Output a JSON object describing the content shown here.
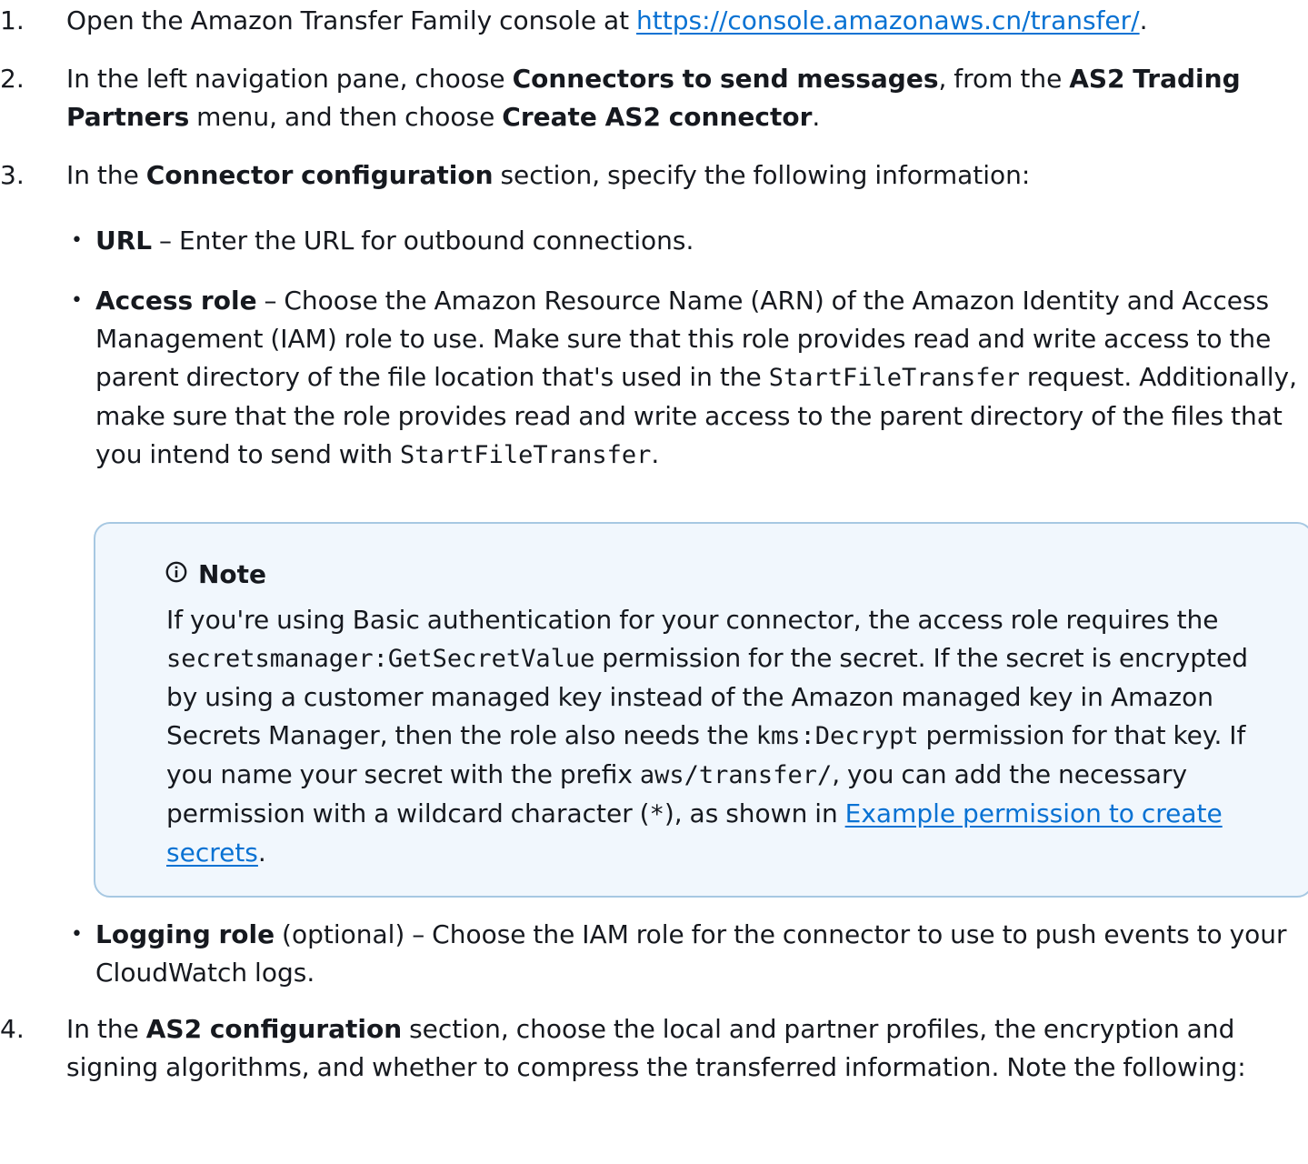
{
  "steps": [
    {
      "num": "1.",
      "t1": "Open the Amazon Transfer Family console at ",
      "link": "https://console.amazonaws.cn/transfer/",
      "t2": "."
    },
    {
      "num": "2.",
      "t1": "In the left navigation pane, choose ",
      "b1": "Connectors to send messages",
      "t2": ", from the ",
      "b2": "AS2 Trading Partners",
      "t3": " menu, and then choose ",
      "b3": "Create AS2 connector",
      "t4": "."
    },
    {
      "num": "3.",
      "t1": "In the ",
      "b1": "Connector configuration",
      "t2": " section, specify the following information:",
      "bullets": {
        "url": {
          "label": "URL",
          "text": " – Enter the URL for outbound connections."
        },
        "access_role": {
          "label": "Access role",
          "t1": " – Choose the Amazon Resource Name (ARN) of the Amazon Identity and Access Management (IAM) role to use. Make sure that this role provides read and write access to the parent directory of the file location that's used in the ",
          "code1": "StartFileTransfer",
          "t2": " request. Additionally, make sure that the role provides read and write access to the parent directory of the files that you intend to send with ",
          "code2": "StartFileTransfer",
          "t3": "."
        },
        "logging_role": {
          "label": "Logging role",
          "t1": " (optional) – Choose the IAM role for the connector to use to push events to your CloudWatch logs."
        }
      },
      "note": {
        "icon": "info-icon",
        "title": "Note",
        "t1": "If you're using Basic authentication for your connector, the access role requires the ",
        "code1": "secretsmanager:GetSecretValue",
        "t2": " permission for the secret. If the secret is encrypted by using a customer managed key instead of the Amazon managed key in Amazon Secrets Manager, then the role also needs the ",
        "code2": "kms:Decrypt",
        "t3": " permission for that key. If you name your secret with the prefix ",
        "code3": "aws/transfer/",
        "t4": ", you can add the necessary permission with a wildcard character (",
        "code4": "*",
        "t5": "), as shown in ",
        "link": "Example permission to create secrets",
        "t6": "."
      }
    },
    {
      "num": "4.",
      "t1": "In the ",
      "b1": "AS2 configuration",
      "t2": " section, choose the local and partner profiles, the encryption and signing algorithms, and whether to compress the transferred information. Note the following:"
    }
  ],
  "colors": {
    "text": "#16191f",
    "link": "#0972d3",
    "note_bg": "#f1f7fd",
    "note_border": "#a7c8e2"
  }
}
